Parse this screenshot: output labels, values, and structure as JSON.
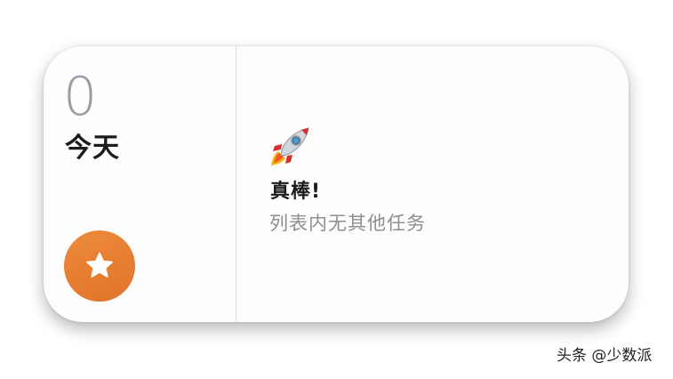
{
  "widget": {
    "count": "0",
    "list_name": "今天",
    "empty_title": "真棒!",
    "empty_subtitle": "列表内无其他任务",
    "icons": {
      "action": "star-icon",
      "empty_state": "rocket-icon"
    },
    "colors": {
      "accent": "#e47b31",
      "count": "#9a9da6",
      "subtitle": "#8e8e93"
    }
  },
  "watermark": "头条 @少数派"
}
